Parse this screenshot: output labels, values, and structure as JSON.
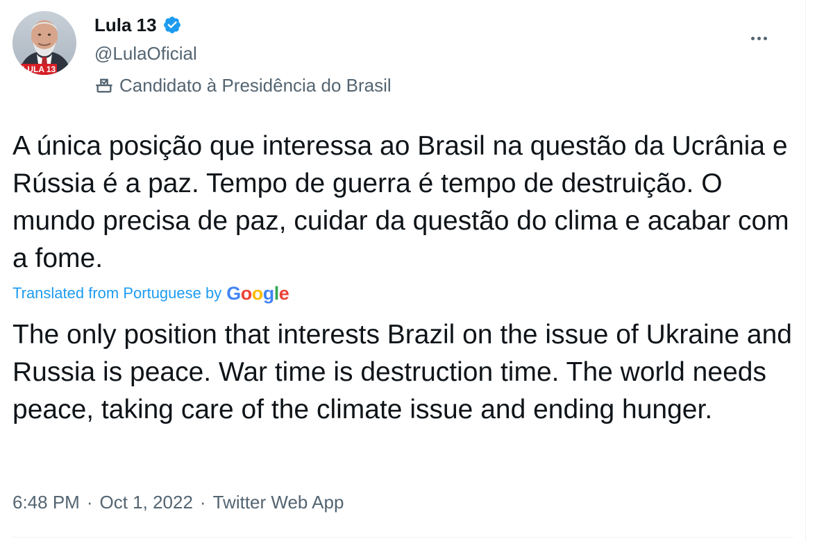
{
  "tweet": {
    "author": {
      "name": "Lula 13",
      "handle": "@LulaOficial",
      "label": "Candidato à Presidência do Brasil",
      "avatar_caption": "LULA 13",
      "verified_color": "#1d9bf0"
    },
    "text": "A única posição que interessa ao Brasil na questão da Ucrânia e Rússia é a paz. Tempo de guerra é tempo de destruição. O mundo precisa de paz, cuidar da questão do clima e acabar com a fome.",
    "translation": {
      "note": "Translated from Portuguese by",
      "provider": "Google",
      "text": "The only position that interests Brazil on the issue of Ukraine and Russia is peace. War time is destruction time. The world needs peace, taking care of the climate issue and ending hunger."
    },
    "meta": {
      "time": "6:48 PM",
      "date": "Oct 1, 2022",
      "source": "Twitter Web App",
      "separator": "·"
    }
  },
  "icons": {
    "verified": "verified-badge-icon",
    "ballot": "ballot-box-icon",
    "more": "more-options-icon"
  },
  "colors": {
    "accent": "#1d9bf0",
    "text": "#0f1419",
    "secondary_text": "#536471"
  }
}
